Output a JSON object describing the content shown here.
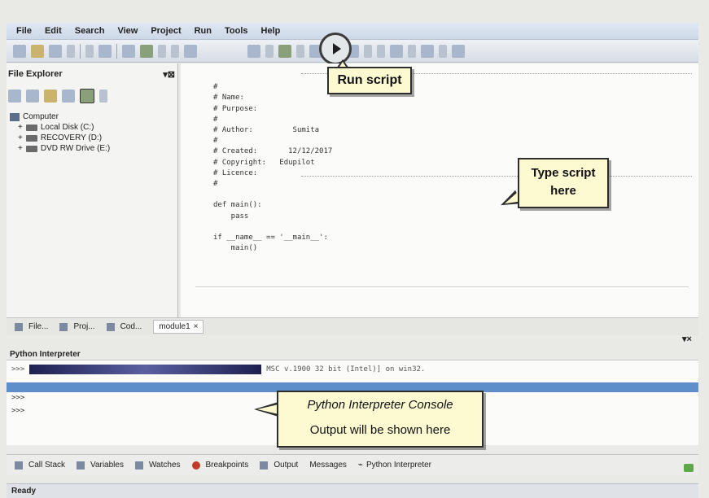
{
  "menu": [
    "File",
    "Edit",
    "Search",
    "View",
    "Project",
    "Run",
    "Tools",
    "Help"
  ],
  "file_explorer": {
    "title": "File Explorer",
    "tree": [
      {
        "label": "Computer",
        "icon": "computer-icon"
      },
      {
        "label": "Local Disk (C:)",
        "icon": "drive-icon"
      },
      {
        "label": "RECOVERY (D:)",
        "icon": "drive-icon"
      },
      {
        "label": "DVD RW Drive (E:)",
        "icon": "dvd-icon"
      }
    ]
  },
  "editor": {
    "code_lines": [
      "#",
      "# Name:      ",
      "# Purpose:",
      "#",
      "# Author:         Sumita",
      "#",
      "# Created:       12/12/2017",
      "# Copyright:   Edupilot",
      "# Licence:",
      "#",
      "",
      "def main():",
      "    pass",
      "",
      "if __name__ == '__main__':",
      "    main()"
    ],
    "tab_label": "module1"
  },
  "callouts": {
    "run": "Run script",
    "type_script": [
      "Type script",
      "here"
    ],
    "console": [
      "Python Interpreter Console",
      "Output will be shown here"
    ]
  },
  "left_tabs": [
    "File...",
    "Proj...",
    "Cod..."
  ],
  "interpreter": {
    "title": "Python Interpreter",
    "version_text": "MSC v.1900 32 bit (Intel)] on win32.",
    "prompt": ">>>"
  },
  "bottom_tabs": [
    "Call Stack",
    "Variables",
    "Watches",
    "Breakpoints",
    "Output",
    "Messages",
    "Python Interpreter"
  ],
  "status": "Ready"
}
